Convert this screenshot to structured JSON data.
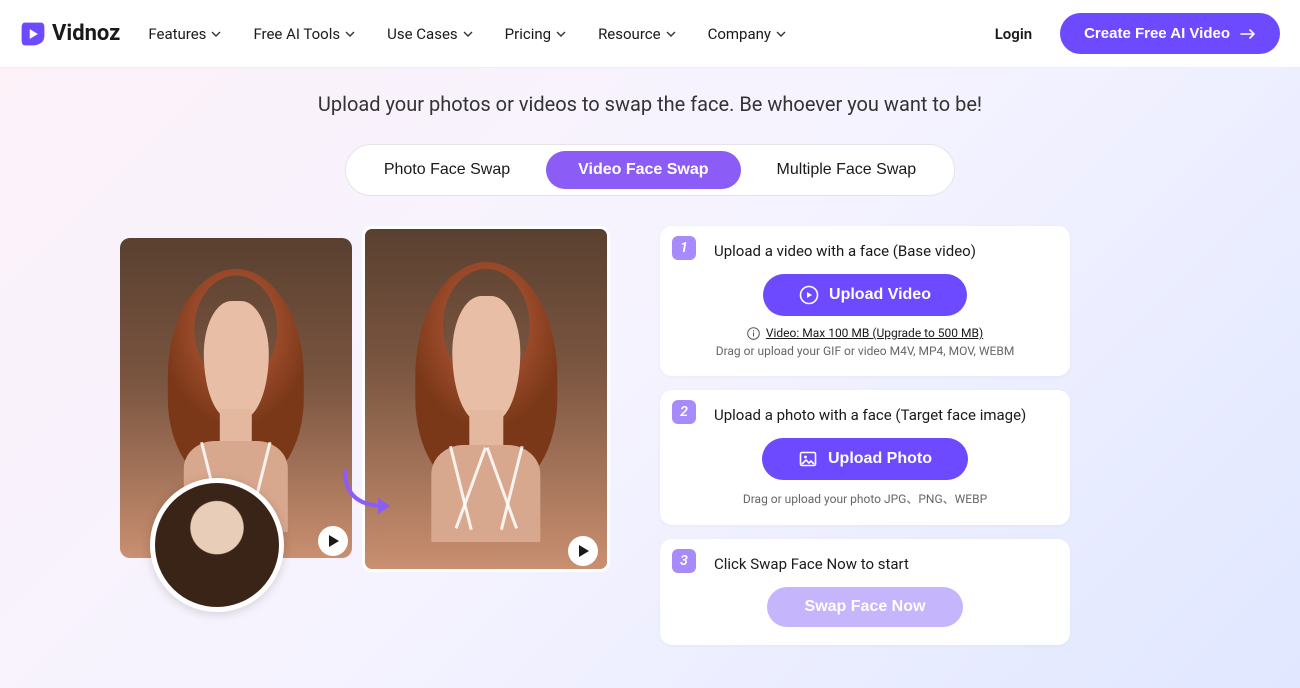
{
  "header": {
    "brand": "Vidnoz",
    "nav": [
      "Features",
      "Free AI Tools",
      "Use Cases",
      "Pricing",
      "Resource",
      "Company"
    ],
    "login": "Login",
    "cta": "Create Free AI Video"
  },
  "subtitle": "Upload your photos or videos to swap the face. Be whoever you want to be!",
  "tabs": {
    "items": [
      "Photo Face Swap",
      "Video Face Swap",
      "Multiple Face Swap"
    ],
    "active_index": 1
  },
  "steps": {
    "s1": {
      "num": "1",
      "title": "Upload a video with a face (Base video)",
      "button": "Upload Video",
      "info_link": "Video: Max 100 MB (Upgrade to 500 MB)",
      "hint": "Drag or upload your GIF or video M4V, MP4, MOV, WEBM"
    },
    "s2": {
      "num": "2",
      "title": "Upload a photo with a face (Target face image)",
      "button": "Upload Photo",
      "hint": "Drag or upload your photo JPG、PNG、WEBP"
    },
    "s3": {
      "num": "3",
      "title": "Click Swap Face Now to start",
      "button": "Swap Face Now"
    }
  },
  "icons": {
    "play": "play-icon",
    "upload_video": "play-circle-icon",
    "upload_photo": "image-icon",
    "info": "info-icon",
    "arrow_right": "arrow-right-icon"
  }
}
